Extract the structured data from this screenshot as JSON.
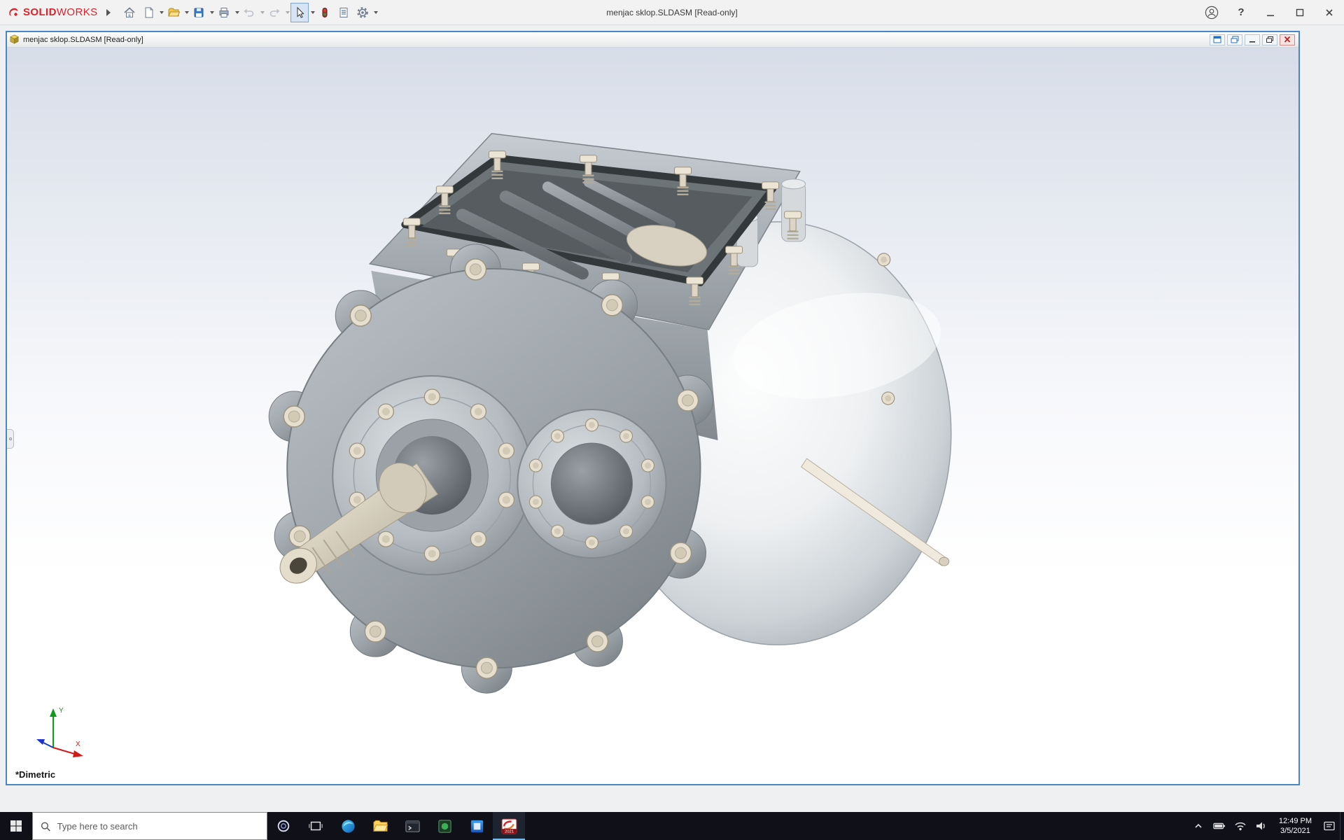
{
  "app": {
    "brand_bold": "SOLID",
    "brand_light": "WORKS",
    "title": "menjac sklop.SLDASM [Read-only]",
    "help_glyph": "?",
    "toolbar_icons": "flyout-arrow, home, new-document, open, save, print, undo, redo, select, rebuild, file-properties, options",
    "window_buttons": "user-account, help, minimize, maximize, close"
  },
  "document_window": {
    "title": "menjac sklop.SLDASM [Read-only]",
    "window_buttons": "tile-window, cascade-window, minimize, restore, close"
  },
  "viewport": {
    "view_label": "*Dimetric",
    "triad_x_label": "X",
    "triad_y_label": "Y",
    "model": "gearbox-assembly"
  },
  "taskbar": {
    "search_placeholder": "Type here to search",
    "app_icons": "start, cortana, task-view, edge, file-explorer, terminal, app-green, app-blue, solidworks",
    "tray_icons": "tray-expand, battery, network, volume, notification-center",
    "solidworks_badge": "2021",
    "clock_time": "12:49 PM",
    "clock_date": "3/5/2021"
  },
  "colors": {
    "accent_blue": "#4a86c5",
    "logo_red": "#d8232a",
    "taskbar_bg": "#101019",
    "viewport_gradient_top": "#d7dde8",
    "viewport_gradient_bottom": "#ffffff",
    "housing_gray": "#9aa1a7",
    "bolt_cream": "#e6dfd0"
  }
}
